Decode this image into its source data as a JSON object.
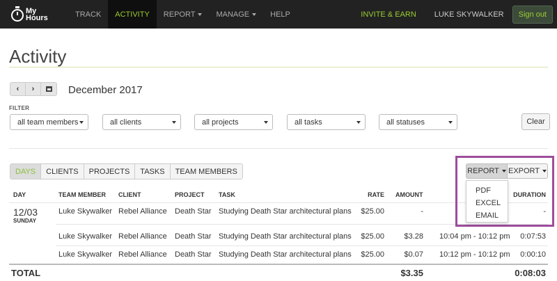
{
  "brand": {
    "line1": "My",
    "line2": "Hours"
  },
  "nav": {
    "items": [
      {
        "label": "TRACK"
      },
      {
        "label": "ACTIVITY"
      },
      {
        "label": "REPORT"
      },
      {
        "label": "MANAGE"
      },
      {
        "label": "HELP"
      }
    ],
    "invite": "INVITE & EARN",
    "user": "LUKE SKYWALKER",
    "signout": "Sign out"
  },
  "page": {
    "title": "Activity",
    "month": "December 2017"
  },
  "filter": {
    "label": "FILTER",
    "selects": [
      "all team members",
      "all clients",
      "all projects",
      "all tasks",
      "all statuses"
    ],
    "clear": "Clear"
  },
  "tabs": [
    "DAYS",
    "CLIENTS",
    "PROJECTS",
    "TASKS",
    "TEAM MEMBERS"
  ],
  "actions": {
    "report": "REPORT",
    "export": "EXPORT",
    "report_menu": [
      "PDF",
      "EXCEL",
      "EMAIL"
    ]
  },
  "table": {
    "headers": {
      "day": "DAY",
      "member": "TEAM MEMBER",
      "client": "CLIENT",
      "project": "PROJECT",
      "task": "TASK",
      "rate": "RATE",
      "amount": "AMOUNT",
      "duration": "DURATION"
    },
    "day": {
      "num": "12/03",
      "name": "SUNDAY"
    },
    "rows": [
      {
        "member": "Luke Skywalker",
        "client": "Rebel Alliance",
        "project": "Death Star",
        "task": "Studying Death Star architectural plans",
        "rate": "$25.00",
        "amount": "-",
        "time": "",
        "duration": "-"
      },
      {
        "member": "Luke Skywalker",
        "client": "Rebel Alliance",
        "project": "Death Star",
        "task": "Studying Death Star architectural plans",
        "rate": "$25.00",
        "amount": "$3.28",
        "time": "10:04 pm - 10:12 pm",
        "duration": "0:07:53"
      },
      {
        "member": "Luke Skywalker",
        "client": "Rebel Alliance",
        "project": "Death Star",
        "task": "Studying Death Star architectural plans",
        "rate": "$25.00",
        "amount": "$0.07",
        "time": "10:12 pm - 10:12 pm",
        "duration": "0:00:10"
      }
    ],
    "total": {
      "label": "TOTAL",
      "amount": "$3.35",
      "duration": "0:08:03"
    }
  }
}
